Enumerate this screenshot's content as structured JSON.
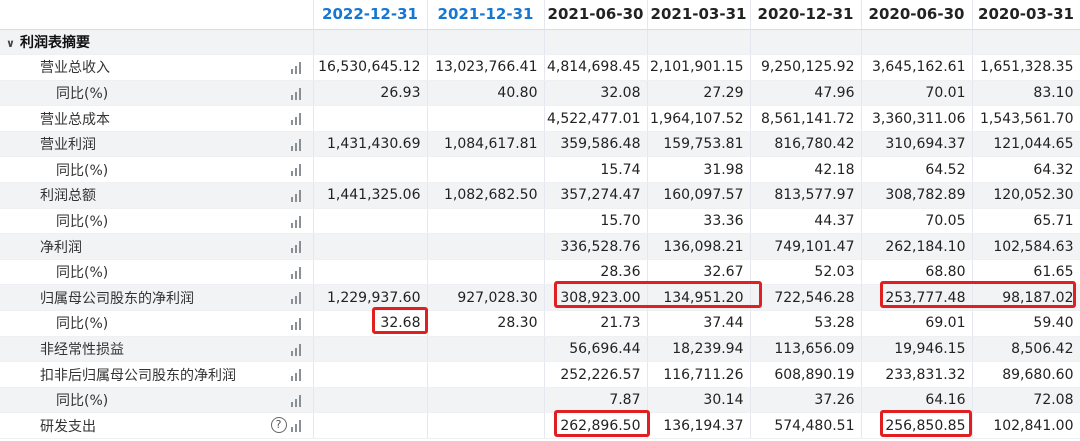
{
  "columns": [
    "2022-12-31",
    "2021-12-31",
    "2021-06-30",
    "2021-03-31",
    "2020-12-31",
    "2020-06-30",
    "2020-03-31"
  ],
  "section": {
    "label": "利润表摘要"
  },
  "rows": [
    {
      "label": "营业总收入",
      "sub": false,
      "help": false,
      "values": [
        "16,530,645.12",
        "13,023,766.41",
        "4,814,698.45",
        "2,101,901.15",
        "9,250,125.92",
        "3,645,162.61",
        "1,651,328.35"
      ]
    },
    {
      "label": "同比(%)",
      "sub": true,
      "help": false,
      "values": [
        "26.93",
        "40.80",
        "32.08",
        "27.29",
        "47.96",
        "70.01",
        "83.10"
      ]
    },
    {
      "label": "营业总成本",
      "sub": false,
      "help": false,
      "values": [
        "",
        "",
        "4,522,477.01",
        "1,964,107.52",
        "8,561,141.72",
        "3,360,311.06",
        "1,543,561.70"
      ]
    },
    {
      "label": "营业利润",
      "sub": false,
      "help": false,
      "values": [
        "1,431,430.69",
        "1,084,617.81",
        "359,586.48",
        "159,753.81",
        "816,780.42",
        "310,694.37",
        "121,044.65"
      ]
    },
    {
      "label": "同比(%)",
      "sub": true,
      "help": false,
      "values": [
        "",
        "",
        "15.74",
        "31.98",
        "42.18",
        "64.52",
        "64.32"
      ]
    },
    {
      "label": "利润总额",
      "sub": false,
      "help": false,
      "values": [
        "1,441,325.06",
        "1,082,682.50",
        "357,274.47",
        "160,097.57",
        "813,577.97",
        "308,782.89",
        "120,052.30"
      ]
    },
    {
      "label": "同比(%)",
      "sub": true,
      "help": false,
      "values": [
        "",
        "",
        "15.70",
        "33.36",
        "44.37",
        "70.05",
        "65.71"
      ]
    },
    {
      "label": "净利润",
      "sub": false,
      "help": false,
      "values": [
        "",
        "",
        "336,528.76",
        "136,098.21",
        "749,101.47",
        "262,184.10",
        "102,584.63"
      ]
    },
    {
      "label": "同比(%)",
      "sub": true,
      "help": false,
      "values": [
        "",
        "",
        "28.36",
        "32.67",
        "52.03",
        "68.80",
        "61.65"
      ]
    },
    {
      "label": "归属母公司股东的净利润",
      "sub": false,
      "help": false,
      "values": [
        "1,229,937.60",
        "927,028.30",
        "308,923.00",
        "134,951.20",
        "722,546.28",
        "253,777.48",
        "98,187.02"
      ]
    },
    {
      "label": "同比(%)",
      "sub": true,
      "help": false,
      "values": [
        "32.68",
        "28.30",
        "21.73",
        "37.44",
        "53.28",
        "69.01",
        "59.40"
      ]
    },
    {
      "label": "非经常性损益",
      "sub": false,
      "help": false,
      "values": [
        "",
        "",
        "56,696.44",
        "18,239.94",
        "113,656.09",
        "19,946.15",
        "8,506.42"
      ]
    },
    {
      "label": "扣非后归属母公司股东的净利润",
      "sub": false,
      "help": false,
      "values": [
        "",
        "",
        "252,226.57",
        "116,711.26",
        "608,890.19",
        "233,831.32",
        "89,680.60"
      ]
    },
    {
      "label": "同比(%)",
      "sub": true,
      "help": false,
      "values": [
        "",
        "",
        "7.87",
        "30.14",
        "37.26",
        "64.16",
        "72.08"
      ]
    },
    {
      "label": "研发支出",
      "sub": false,
      "help": true,
      "values": [
        "",
        "",
        "262,896.50",
        "136,194.37",
        "574,480.51",
        "256,850.85",
        "102,841.00"
      ]
    }
  ],
  "colors": {
    "future_header": "#1677d2",
    "highlight": "#e02020",
    "alt_row": "#f2f3f5"
  },
  "icons": {
    "chart": "bar-chart-icon",
    "help": "question-circle-icon",
    "collapse": "chevron-down-icon"
  },
  "help_glyph": "?",
  "collapse_glyph": "∨"
}
